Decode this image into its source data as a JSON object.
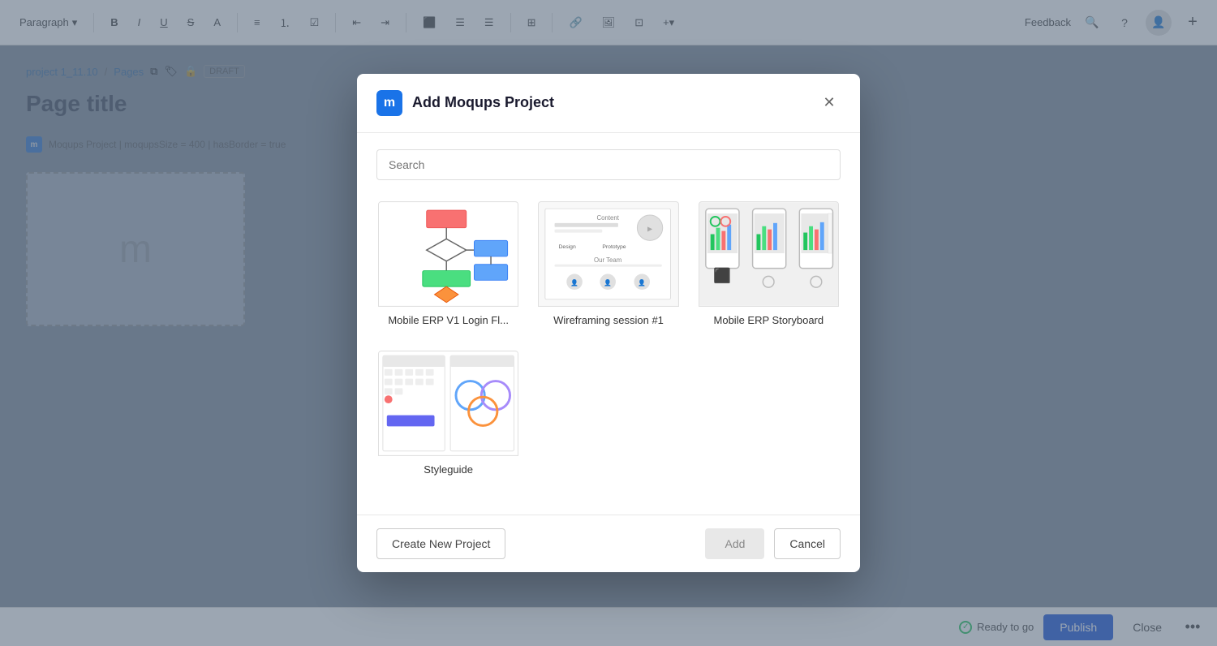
{
  "toolbar": {
    "paragraph_label": "Paragraph",
    "bold": "B",
    "italic": "I",
    "underline": "U",
    "feedback_label": "Feedback"
  },
  "editor": {
    "breadcrumb_project": "project 1_11.10",
    "breadcrumb_sep": "/",
    "breadcrumb_pages": "Pages",
    "draft_badge": "DRAFT",
    "page_title": "Page title",
    "embed_info": "Moqups Project | moqupsSize = 400 | hasBorder = true"
  },
  "bottom_bar": {
    "ready_label": "Ready to go",
    "publish_label": "Publish",
    "close_label": "Close"
  },
  "modal": {
    "title": "Add Moqups Project",
    "logo_letter": "m",
    "search_placeholder": "Search",
    "projects": [
      {
        "id": "project-1",
        "name": "Mobile ERP V1 Login Fl...",
        "type": "flowchart"
      },
      {
        "id": "project-2",
        "name": "Wireframing session #1",
        "type": "wireframe"
      },
      {
        "id": "project-3",
        "name": "Mobile ERP Storyboard",
        "type": "storyboard"
      },
      {
        "id": "project-4",
        "name": "Styleguide",
        "type": "styleguide"
      }
    ],
    "create_new_label": "Create New Project",
    "add_label": "Add",
    "cancel_label": "Cancel"
  }
}
